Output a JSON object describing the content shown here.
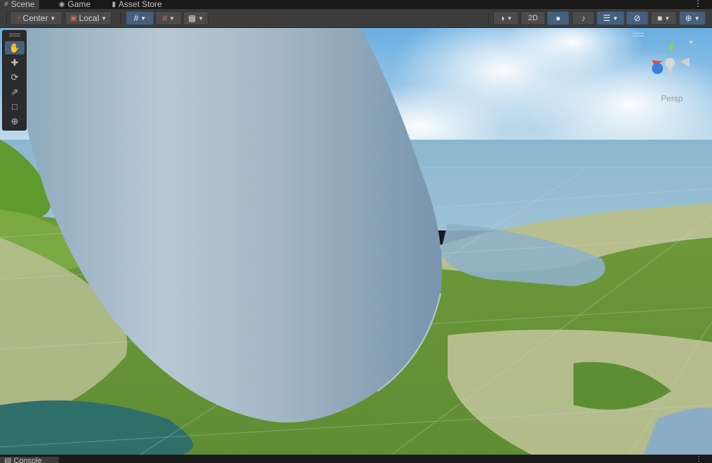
{
  "tabs": [
    {
      "label": "Scene",
      "icon": "grid-icon",
      "active": true
    },
    {
      "label": "Game",
      "icon": "gamepad-icon",
      "active": false
    },
    {
      "label": "Asset Store",
      "icon": "store-bag-icon",
      "active": false
    }
  ],
  "toolbar": {
    "pivot_mode": "Center",
    "pivot_rotation": "Local",
    "mode_2d": "2D"
  },
  "tools": [
    {
      "name": "hand",
      "icon": "hand-icon",
      "active": true
    },
    {
      "name": "move",
      "icon": "move-icon",
      "active": false
    },
    {
      "name": "rotate",
      "icon": "rotate-icon",
      "active": false
    },
    {
      "name": "scale",
      "icon": "scale-icon",
      "active": false
    },
    {
      "name": "rect",
      "icon": "rect-icon",
      "active": false
    },
    {
      "name": "transform",
      "icon": "transform-icon",
      "active": false
    }
  ],
  "gizmo": {
    "projection": "Persp"
  },
  "bottom_panel": {
    "label": "Console"
  },
  "colors": {
    "active_blue": "#46607c",
    "toolbar": "#3c3c3c",
    "background": "#191919"
  }
}
